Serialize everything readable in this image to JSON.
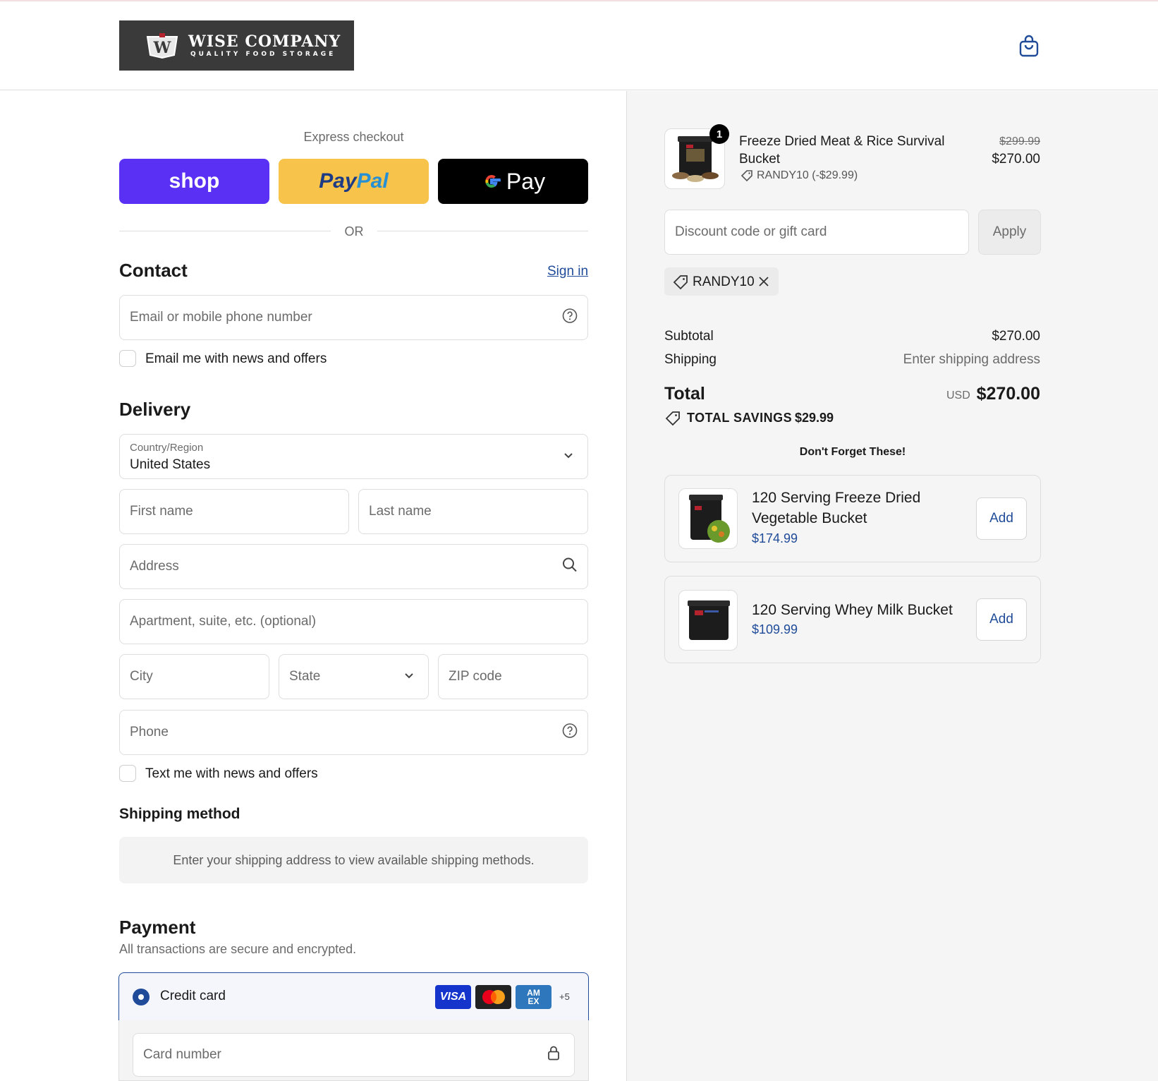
{
  "header": {
    "logo_name": "WISE COMPANY",
    "logo_tagline": "QUALITY FOOD STORAGE",
    "cart_icon": "shopping-bag-icon"
  },
  "express": {
    "title": "Express checkout",
    "shop_label": "shop",
    "paypal_part1": "Pay",
    "paypal_part2": "Pal",
    "gpay_label": "Pay",
    "or_label": "OR"
  },
  "contact": {
    "title": "Contact",
    "sign_in": "Sign in",
    "email_placeholder": "Email or mobile phone number",
    "email_optin": "Email me with news and offers"
  },
  "delivery": {
    "title": "Delivery",
    "country_label": "Country/Region",
    "country_value": "United States",
    "first_name": "First name",
    "last_name": "Last name",
    "address": "Address",
    "apartment": "Apartment, suite, etc. (optional)",
    "city": "City",
    "state": "State",
    "zip": "ZIP code",
    "phone": "Phone",
    "sms_optin": "Text me with news and offers"
  },
  "shipping_method": {
    "title": "Shipping method",
    "message": "Enter your shipping address to view available shipping methods."
  },
  "payment": {
    "title": "Payment",
    "subtitle": "All transactions are secure and encrypted.",
    "credit_card_label": "Credit card",
    "card_visa": "VISA",
    "card_amex_1": "AM",
    "card_amex_2": "EX",
    "more_cards": "+5",
    "card_number_placeholder": "Card number"
  },
  "order": {
    "item": {
      "quantity": "1",
      "name_line1": "Freeze Dried Meat & Rice Survival",
      "name_line2": "Bucket",
      "discount": "RANDY10 (-$29.99)",
      "original_price": "$299.99",
      "price": "$270.00"
    },
    "discount_placeholder": "Discount code or gift card",
    "apply_label": "Apply",
    "applied_code": "RANDY10",
    "subtotal_label": "Subtotal",
    "subtotal_value": "$270.00",
    "shipping_label": "Shipping",
    "shipping_value": "Enter shipping address",
    "total_label": "Total",
    "currency": "USD",
    "total_value": "$270.00",
    "savings_label": "TOTAL SAVINGS",
    "savings_value": "$29.99"
  },
  "upsell": {
    "title": "Don't Forget These!",
    "items": [
      {
        "name_line1": "120 Serving Freeze Dried",
        "name_line2": "Vegetable Bucket",
        "price": "$174.99",
        "add_label": "Add"
      },
      {
        "name_line1": "120 Serving Whey Milk Bucket",
        "price": "$109.99",
        "add_label": "Add"
      }
    ]
  },
  "colors": {
    "accent": "#1f4b99",
    "shop_purple": "#5a31f4",
    "paypal_yellow": "#f7c34a",
    "link_blue": "#1f4b99"
  }
}
